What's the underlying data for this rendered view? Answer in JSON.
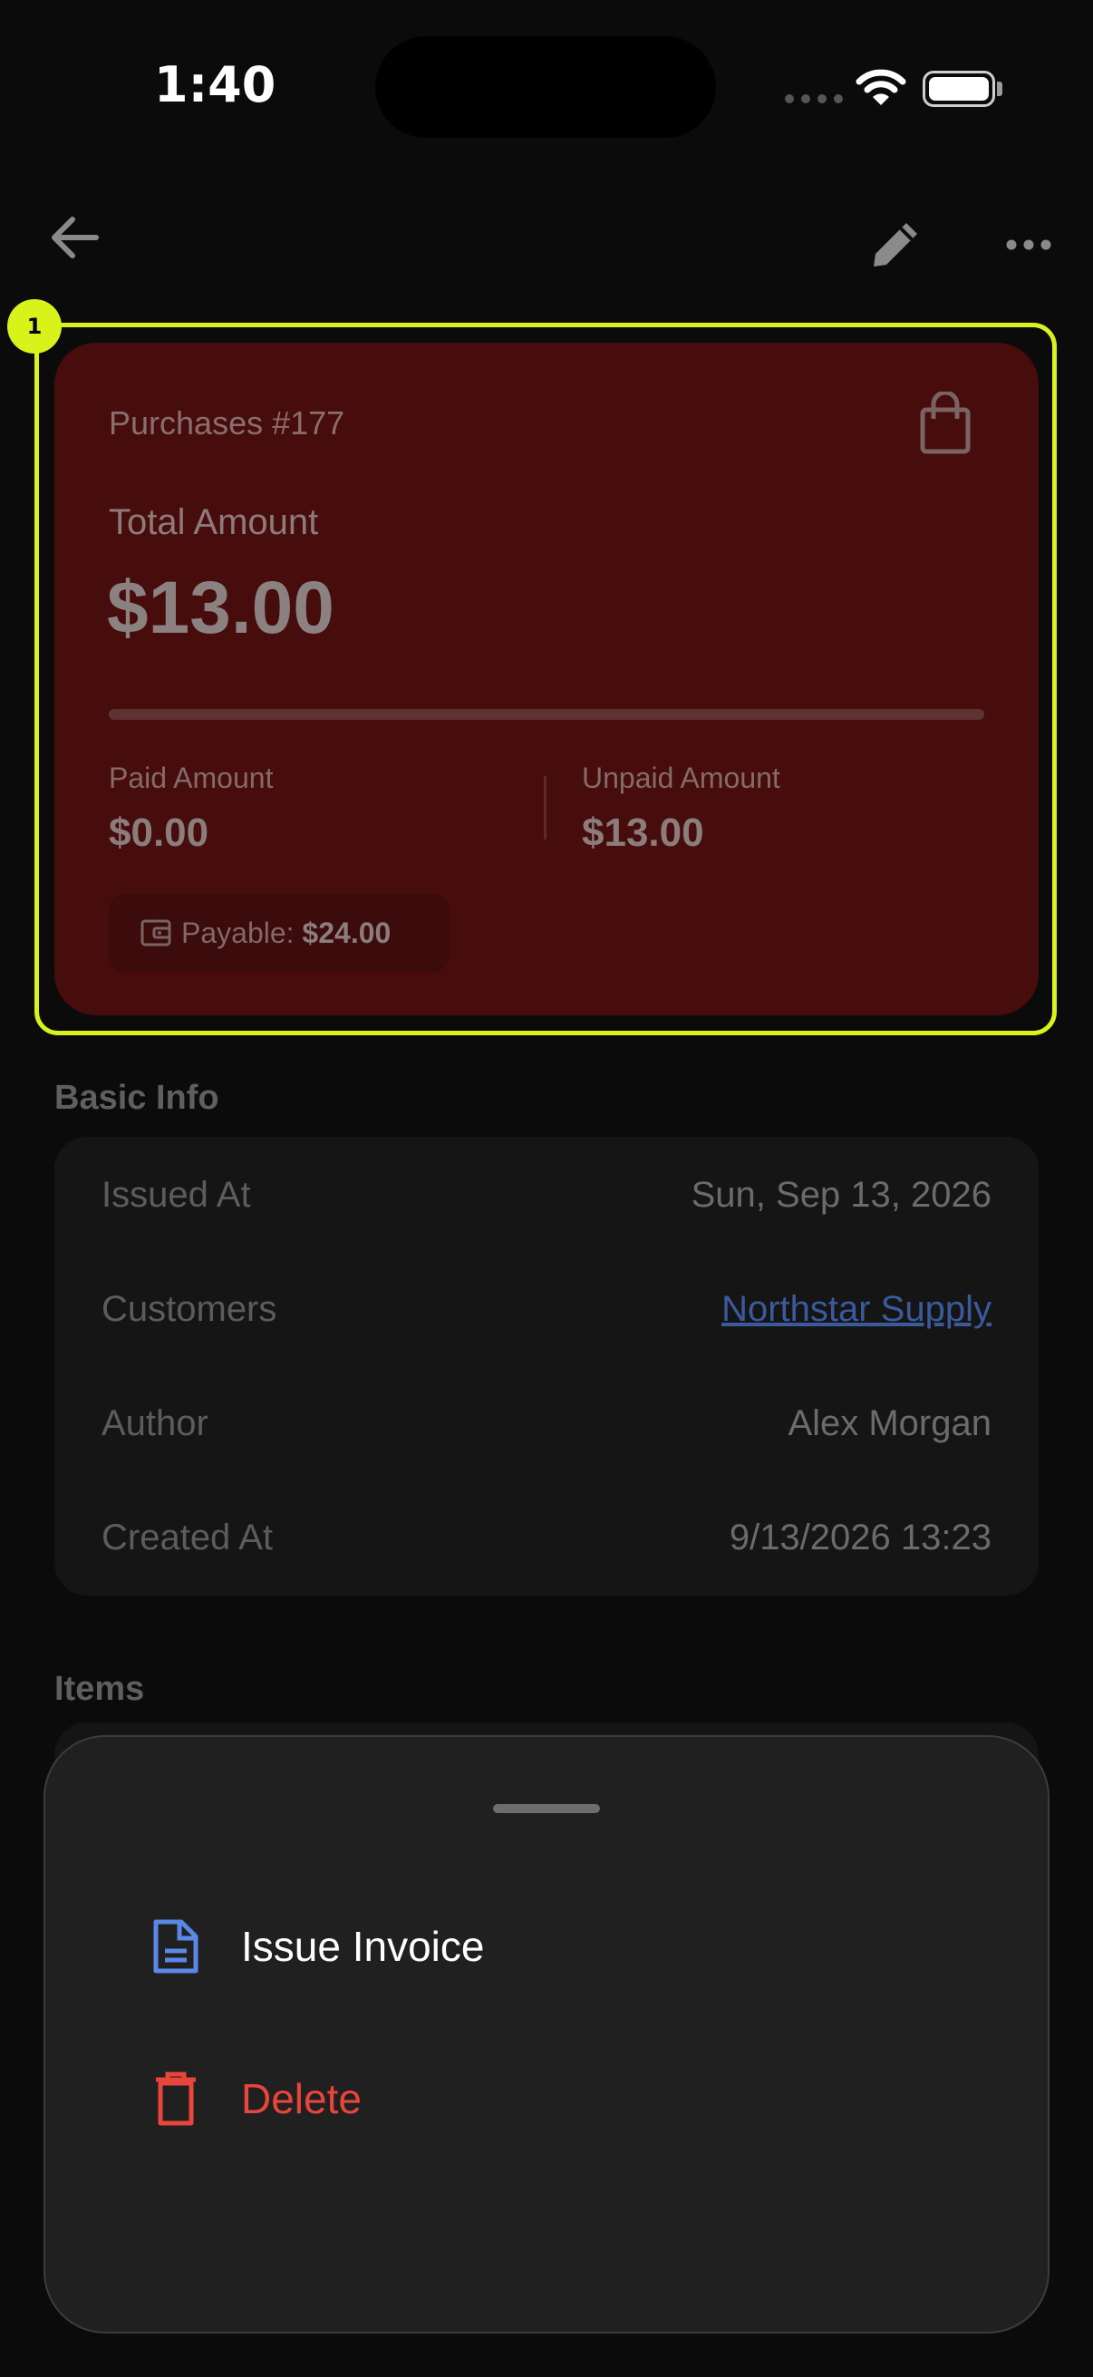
{
  "status_bar": {
    "time": "1:40"
  },
  "app_bar": {
    "back_icon": "arrow-left-icon",
    "edit_icon": "pencil-icon",
    "more_icon": "more-horizontal-icon"
  },
  "annotation": {
    "badge": "1",
    "color": "#d7f31a"
  },
  "summary": {
    "title": "Purchases #177",
    "icon": "shopping-bag-icon",
    "total_label": "Total Amount",
    "total_value": "$13.00",
    "paid_label": "Paid Amount",
    "paid_value": "$0.00",
    "unpaid_label": "Unpaid Amount",
    "unpaid_value": "$13.00",
    "payable_label": "Payable:",
    "payable_value": "$24.00",
    "card_color": "#470c0c"
  },
  "basic_info": {
    "title": "Basic Info",
    "rows": [
      {
        "label": "Issued At",
        "value": "Sun, Sep 13, 2026"
      },
      {
        "label": "Customers",
        "value": "Northstar Supply"
      },
      {
        "label": "Author",
        "value": "Alex Morgan"
      },
      {
        "label": "Created At",
        "value": "9/13/2026 13:23"
      }
    ]
  },
  "items": {
    "title": "Items"
  },
  "sheet": {
    "actions": [
      {
        "label": "Issue Invoice",
        "icon": "document-icon",
        "color": "#5b87e6"
      },
      {
        "label": "Delete",
        "icon": "trash-icon",
        "color": "#e8453c"
      }
    ]
  }
}
